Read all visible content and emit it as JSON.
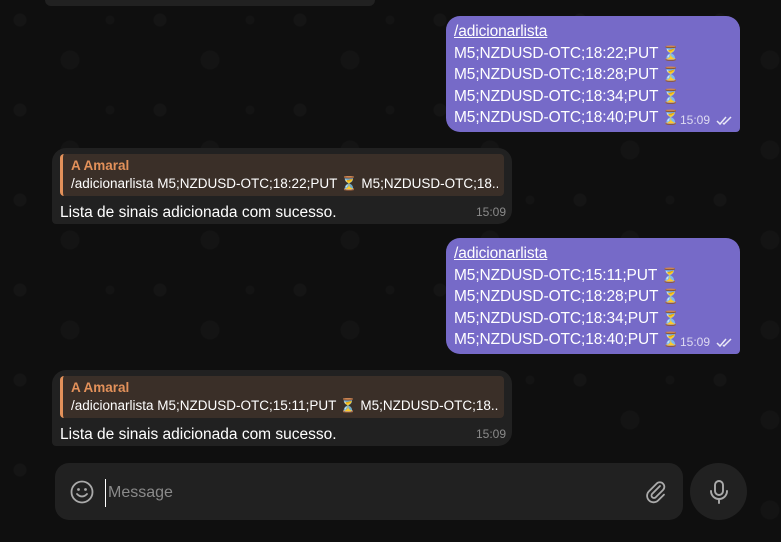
{
  "colors": {
    "outgoing_bubble": "#766ac8",
    "incoming_bubble": "#212121",
    "reply_accent": "#e3915a",
    "background": "#0f0f0f"
  },
  "messages": [
    {
      "type": "outgoing",
      "command": "/adicionarlista",
      "lines": [
        "M5;NZDUSD-OTC;18:22;PUT",
        "M5;NZDUSD-OTC;18:28;PUT",
        "M5;NZDUSD-OTC;18:34;PUT",
        "M5;NZDUSD-OTC;18:40;PUT"
      ],
      "hourglass": "⏳",
      "time": "15:09",
      "status": "read"
    },
    {
      "type": "incoming",
      "reply_name": "A Amaral",
      "reply_text": "/adicionarlista M5;NZDUSD-OTC;18:22;PUT ⏳ M5;NZDUSD-OTC;18...",
      "text": "Lista de sinais adicionada com sucesso.",
      "time": "15:09"
    },
    {
      "type": "outgoing",
      "command": "/adicionarlista",
      "lines": [
        "M5;NZDUSD-OTC;15:11;PUT",
        "M5;NZDUSD-OTC;18:28;PUT",
        "M5;NZDUSD-OTC;18:34;PUT",
        "M5;NZDUSD-OTC;18:40;PUT"
      ],
      "hourglass": "⏳",
      "time": "15:09",
      "status": "read"
    },
    {
      "type": "incoming",
      "reply_name": "A Amaral",
      "reply_text": "/adicionarlista M5;NZDUSD-OTC;15:11;PUT ⏳ M5;NZDUSD-OTC;18...",
      "text": "Lista de sinais adicionada com sucesso.",
      "time": "15:09"
    }
  ],
  "composer": {
    "placeholder": "Message",
    "emoji_icon": "smile-icon",
    "attach_icon": "paperclip-icon",
    "mic_icon": "microphone-icon"
  }
}
